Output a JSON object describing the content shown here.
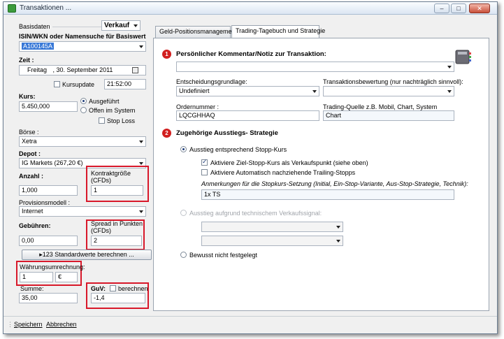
{
  "window": {
    "title": "Transaktionen ...",
    "min": "–",
    "max": "□",
    "close": "✕"
  },
  "left": {
    "group_label": "Basisdaten",
    "direction": "Verkauf",
    "isin_label": "ISIN/WKN oder Namensuche für Basiswert",
    "isin_value": "A100145A",
    "zeit_label": "Zeit :",
    "date_day": "Freitag",
    "date_rest": ", 30. September 2011",
    "kursupdate_label": "Kursupdate",
    "time_value": "21:52:00",
    "kurs_label": "Kurs:",
    "kurs_value": "5.450,000",
    "radio_ausgefuehrt": "Ausgeführt",
    "radio_offen": "Offen im System",
    "stoploss_label": "Stop Loss",
    "boerse_label": "Börse :",
    "boerse_value": "Xetra",
    "depot_label": "Depot :",
    "depot_value": "IG Markets (267,20 €)",
    "anzahl_label": "Anzahl :",
    "anzahl_value": "1,000",
    "kontrakt_label_1": "Kontraktgröße",
    "kontrakt_label_2": "(CFDs)",
    "kontrakt_value": "1",
    "provision_label": "Provisionsmodell :",
    "provision_value": "Internet",
    "gebuehren_label": "Gebühren:",
    "gebuehren_value": "0,00",
    "spread_label_1": "Spread in Punkten",
    "spread_label_2": "(CFDs)",
    "spread_value": "2",
    "standard_button": "▸123 Standardwerte berechnen ...",
    "waehrung_label": "Währungsumrechnung:",
    "waehrung_value": "1",
    "waehrung_symbol": "€",
    "summe_label": "Summe:",
    "summe_value": "35,00",
    "guv_label": "GuV:",
    "guv_check_label": "berechnen",
    "guv_value": "-1,4"
  },
  "tabs": [
    {
      "label": "Geld-Positionsmanagement"
    },
    {
      "label": "Trading-Tagebuch und Strategie"
    }
  ],
  "panel": {
    "step1": "1",
    "section1_title": "Persönlicher Kommentar/Notiz zur Transaktion:",
    "comment_value": "",
    "entscheidung_label": "Entscheidungsgrundlage:",
    "entscheidung_value": "Undefiniert",
    "bewertung_label": "Transaktionsbewertung (nur nachträglich sinnvoll):",
    "bewertung_value": "",
    "order_label": "Ordernummer :",
    "order_value": "LQCGHHAQ",
    "quelle_label": "Trading-Quelle z.B. Mobil, Chart, System",
    "quelle_value": "Chart",
    "step2": "2",
    "section2_title": "Zugehörige Ausstiegs- Strategie",
    "radio_stopp": "Ausstieg entsprechend Stopp-Kurs",
    "check_ziel": "Aktiviere Ziel-Stopp-Kurs als Verkaufspunkt (siehe oben)",
    "check_trailing": "Aktiviere Automatisch nachziehende Trailing-Stopps",
    "anmerkung_label": "Anmerkungen für die Stopkurs-Setzung (Initial, Ein-Stop-Variante, Aus-Stop-Strategie, Technik):",
    "anmerkung_value": "1x TS",
    "radio_technisch": "Ausstieg aufgrund technischem Verkaufssignal:",
    "radio_bewusst": "Bewusst nicht festgelegt"
  },
  "footer": {
    "save": "Speichern",
    "cancel": "Abbrechen"
  }
}
